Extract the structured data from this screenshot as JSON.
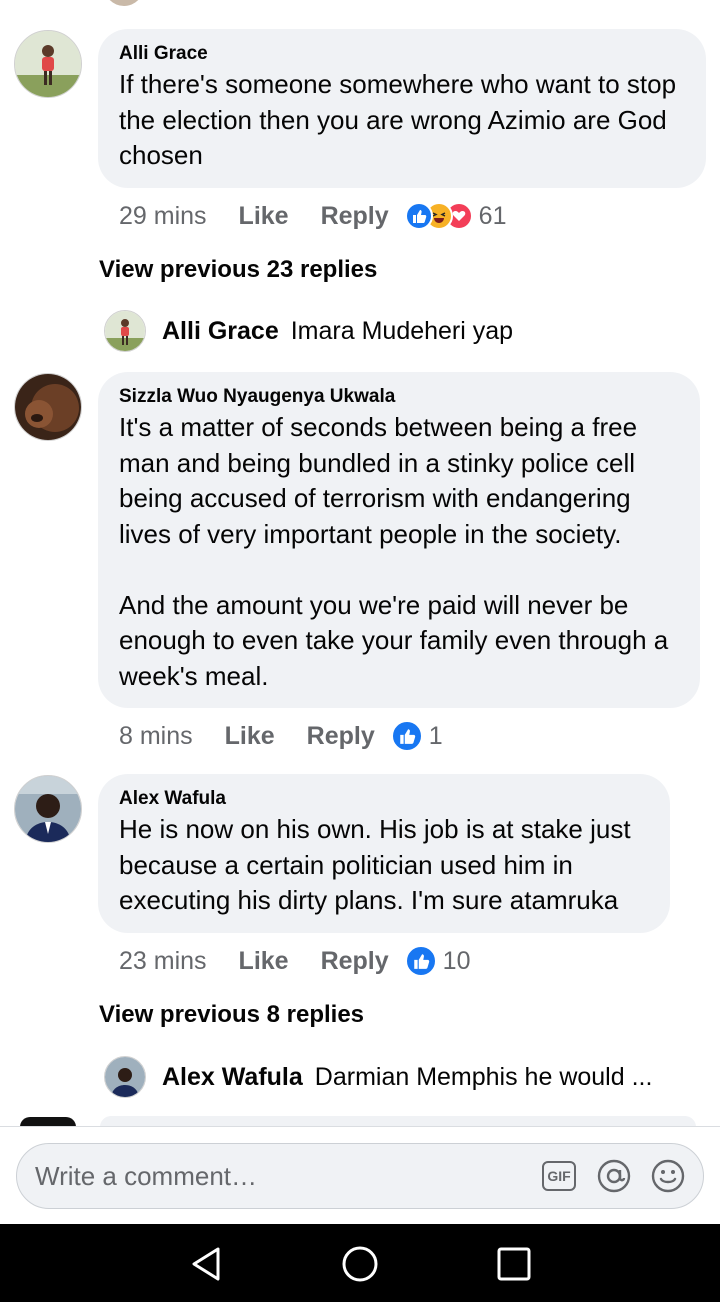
{
  "comments": [
    {
      "author": "Alli Grace",
      "text": "If there's someone somewhere who want to stop the election then you are wrong Azimio are God chosen",
      "time": "29 mins",
      "like_label": "Like",
      "reply_label": "Reply",
      "reactions": [
        "like",
        "haha",
        "love"
      ],
      "reaction_count": "61"
    },
    {
      "author": "Sizzla Wuo Nyaugenya Ukwala",
      "text": "It's a matter of seconds between being a free man and being bundled in a stinky police cell being accused of terrorism with endangering lives of very important people in the society.\n\nAnd the amount you we're paid will never be enough to even take your family even through a week's meal.",
      "time": "8 mins",
      "like_label": "Like",
      "reply_label": "Reply",
      "reactions": [
        "like"
      ],
      "reaction_count": "1"
    },
    {
      "author": "Alex Wafula",
      "text": "He is now on his own. His job is at stake just because a certain politician used him in executing his dirty plans. I'm sure atamruka",
      "time": "23 mins",
      "like_label": "Like",
      "reply_label": "Reply",
      "reactions": [
        "like"
      ],
      "reaction_count": "10"
    }
  ],
  "view_previous_1": "View previous 23 replies",
  "view_previous_2": "View previous 8 replies",
  "reply_previews": [
    {
      "author": "Alli Grace",
      "text": "Imara Mudeheri yap"
    },
    {
      "author": "Alex Wafula",
      "text": "Darmian Memphis he would ..."
    }
  ],
  "composer": {
    "placeholder": "Write a comment…",
    "gif_label": "GIF",
    "icons": [
      "gif-icon",
      "mention-icon",
      "emoji-icon"
    ]
  },
  "colors": {
    "like_blue": "#1877f2",
    "love_red": "#f33e58",
    "haha_yellow": "#f7b125",
    "bubble": "#f0f2f5",
    "meta_grey": "#65676b"
  },
  "system_nav": [
    "back-icon",
    "home-icon",
    "recents-icon"
  ]
}
